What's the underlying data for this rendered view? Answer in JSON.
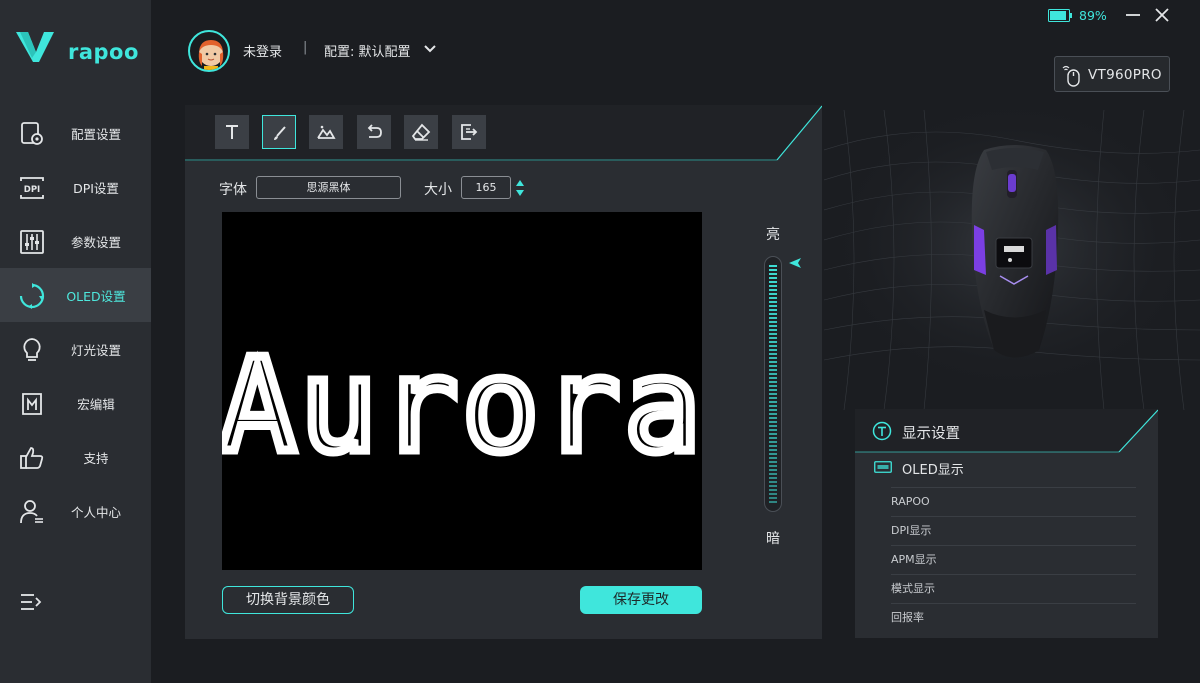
{
  "brand": {
    "logo_text": "rapoo",
    "accent": "#3fe6dc"
  },
  "sidebar": {
    "items": [
      {
        "label": "配置设置",
        "icon": "config-icon"
      },
      {
        "label": "DPI设置",
        "icon": "dpi-icon"
      },
      {
        "label": "参数设置",
        "icon": "sliders-icon"
      },
      {
        "label": "OLED设置",
        "icon": "oled-refresh-icon",
        "active": true
      },
      {
        "label": "灯光设置",
        "icon": "bulb-icon"
      },
      {
        "label": "宏编辑",
        "icon": "macro-icon"
      },
      {
        "label": "支持",
        "icon": "thumbs-up-icon"
      },
      {
        "label": "个人中心",
        "icon": "user-icon"
      }
    ]
  },
  "header": {
    "user_status": "未登录",
    "separator": "|",
    "profile_label": "配置: 默认配置"
  },
  "window": {
    "battery_percent": "89%"
  },
  "device": {
    "name": "VT960PRO"
  },
  "editor": {
    "tools": [
      "text-tool-icon",
      "brush-tool-icon",
      "image-tool-icon",
      "undo-icon",
      "eraser-icon",
      "export-icon"
    ],
    "active_tool": "brush-tool-icon",
    "font_label": "字体",
    "font_value": "思源黑体",
    "size_label": "大小",
    "size_value": "165",
    "canvas_text": "Aurora",
    "brightness_high_label": "亮",
    "brightness_low_label": "暗",
    "brightness_level": 1.0,
    "toggle_bg_label": "切换背景颜色",
    "save_label": "保存更改"
  },
  "display_settings": {
    "title": "显示设置",
    "oled_label": "OLED显示",
    "options": [
      "RAPOO",
      "DPI显示",
      "APM显示",
      "模式显示",
      "回报率"
    ]
  }
}
